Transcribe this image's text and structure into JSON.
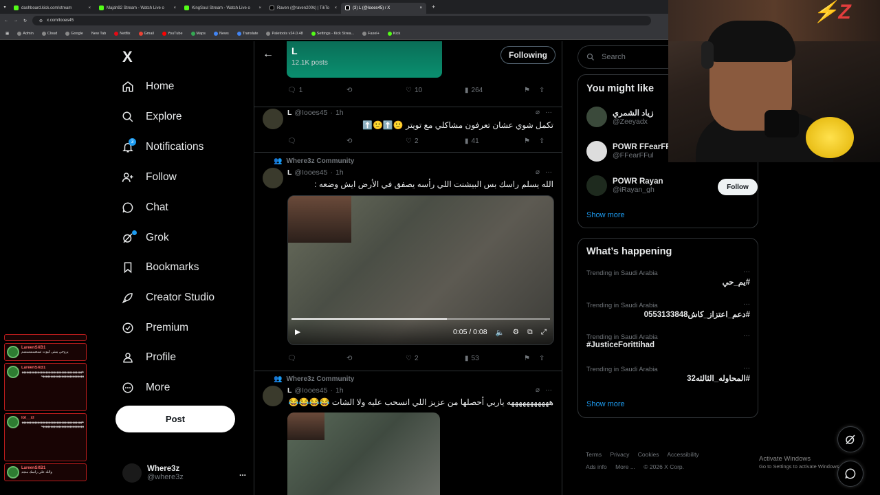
{
  "browser": {
    "tabs": [
      {
        "label": "dashboard.kick.com/stream"
      },
      {
        "label": "Majah92 Stream - Watch Live o"
      },
      {
        "label": "KingSoul Stream - Watch Live o"
      },
      {
        "label": "Raven (@raven200k) | TikTo"
      },
      {
        "label": "(3) L (@Iooes45) / X"
      }
    ],
    "new_tab": "+",
    "url": "x.com/Iooes45",
    "bookmarks": [
      "Admin",
      "Cloud",
      "Google",
      "New Tab",
      "Netflix",
      "Gmail",
      "YouTube",
      "Maps",
      "News",
      "Translate",
      "Paletools v24.0.48",
      "Settings - Kick Strea...",
      "Faxel+",
      "Kick"
    ]
  },
  "nav": {
    "logo": "X",
    "items": [
      {
        "label": "Home",
        "icon": "home-icon"
      },
      {
        "label": "Explore",
        "icon": "search-icon"
      },
      {
        "label": "Notifications",
        "icon": "bell-icon"
      },
      {
        "label": "Follow",
        "icon": "person-plus-icon"
      },
      {
        "label": "Chat",
        "icon": "chat-icon"
      },
      {
        "label": "Grok",
        "icon": "grok-icon"
      },
      {
        "label": "Bookmarks",
        "icon": "bookmark-icon"
      },
      {
        "label": "Creator Studio",
        "icon": "rocket-icon"
      },
      {
        "label": "Premium",
        "icon": "verified-icon"
      },
      {
        "label": "Profile",
        "icon": "person-icon"
      },
      {
        "label": "More",
        "icon": "more-circle-icon"
      }
    ],
    "notification_badge": "3",
    "post_label": "Post",
    "account": {
      "name": "Where3z",
      "handle": "@where3z",
      "menu": "..."
    }
  },
  "chat_overlay": [
    {
      "name": "",
      "text": ""
    },
    {
      "name": "LareenSXB1",
      "text": "يروحي يمتي كيوت تسعسسسسم"
    },
    {
      "name": "LareenSXB1",
      "text": "هههههههههههههههههههههههههههههههههههههههههههههههههههههههههههههههههه"
    },
    {
      "name": "lol__xl",
      "text": "هههههههههههههههههههههههههههههههههههههههههههههههههههههههههههههههههه"
    },
    {
      "name": "LareenSXB1",
      "text": "والله على راسك منجد"
    }
  ],
  "header": {
    "name": "L",
    "posts": "12.1K posts",
    "following_label": "Following"
  },
  "tweets": [
    {
      "replies": "1",
      "retweets": "",
      "likes": "10",
      "views": "264"
    },
    {
      "name": "L",
      "handle": "@Iooes45",
      "time": "1h",
      "text": "تكمل شوي عشان تعرفون مشاكلي مع تويتر 🙂⬆️🙂⬆️",
      "replies": "",
      "retweets": "",
      "likes": "2",
      "views": "41"
    },
    {
      "community": "Where3z Community",
      "name": "L",
      "handle": "@Iooes45",
      "time": "1h",
      "text": "الله يسلم راسك بس البيشنت اللي رأسه يصفق في الأرض ايش وضعه :",
      "video": {
        "time": "0:05 / 0:08",
        "progress": 0.6
      },
      "replies": "",
      "retweets": "",
      "likes": "2",
      "views": "53"
    },
    {
      "community": "Where3z Community",
      "name": "L",
      "handle": "@Iooes45",
      "time": "1h",
      "text": "هههههههههههه ياربي أحصلها من عزيز اللي انسحب عليه ولا الشات 😂😂😂😂"
    }
  ],
  "right": {
    "search_placeholder": "Search",
    "you_might_like": {
      "title": "You might like",
      "users": [
        {
          "name": "زياد الشمري",
          "handle": "@Zeeyadx"
        },
        {
          "name": "POWR FFearFFu",
          "handle": "@FFearFFul"
        },
        {
          "name": "POWR Rayan",
          "handle": "@iRayan_gh"
        }
      ],
      "follow_label": "Follow",
      "show_more": "Show more"
    },
    "happening": {
      "title": "What’s happening",
      "trends": [
        {
          "context": "Trending in Saudi Arabia",
          "name": "#يم_حي"
        },
        {
          "context": "Trending in Saudi Arabia",
          "name": "#دعم_اعتزاز_كاش0553133848"
        },
        {
          "context": "Trending in Saudi Arabia",
          "name": "#JusticeForittihad"
        },
        {
          "context": "Trending in Saudi Arabia",
          "name": "#المحاوله_الثالثه32"
        }
      ],
      "show_more": "Show more"
    },
    "footer": [
      "Terms",
      "Privacy",
      "Cookies",
      "Accessibility",
      "Ads info",
      "More ...",
      "© 2026 X Corp."
    ],
    "activate": {
      "title": "Activate Windows",
      "subtitle": "Go to Settings to activate Windows."
    }
  }
}
